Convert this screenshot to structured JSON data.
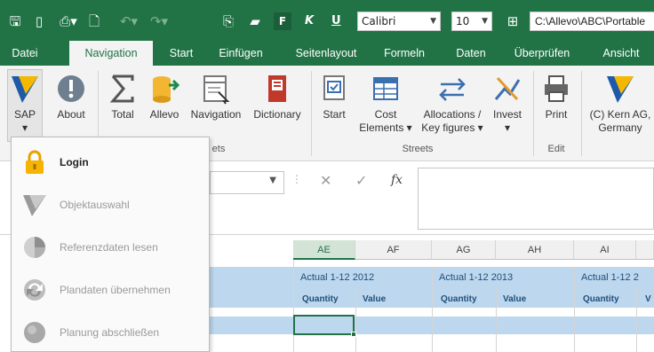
{
  "qat": {
    "font_name": "Calibri",
    "font_size": "10",
    "file_path": "C:\\Allevo\\ABC\\Portable",
    "bold_letter": "F",
    "italic_letter": "K",
    "underline_letter": "U"
  },
  "tabs": [
    "Datei",
    "Navigation",
    "Start",
    "Einfügen",
    "Seitenlayout",
    "Formeln",
    "Daten",
    "Überprüfen",
    "Ansicht"
  ],
  "active_tab": "Navigation",
  "ribbon": {
    "sap": "SAP",
    "about": "About",
    "total": "Total",
    "allevo": "Allevo",
    "navigation": "Navigation",
    "dictionary": "Dictionary",
    "start": "Start",
    "cost_line1": "Cost",
    "cost_line2": "Elements ▾",
    "alloc_line1": "Allocations /",
    "alloc_line2": "Key figures ▾",
    "invest": "Invest",
    "print": "Print",
    "kern_line1": "(C) Kern AG,",
    "kern_line2": "Germany",
    "group_sheets_fragment": "ets",
    "group_streets": "Streets",
    "group_edit": "Edit"
  },
  "formula": {
    "fx": "fx"
  },
  "grid": {
    "columns": [
      "AE",
      "AF",
      "AG",
      "AH",
      "AI"
    ],
    "selected_column": "AE",
    "group_headers": [
      "Actual 1-12 2012",
      "Actual 1-12 2013",
      "Actual 1-12 2"
    ],
    "sub_headers": [
      "Quantity",
      "Value",
      "Quantity",
      "Value",
      "Quantity",
      "V"
    ]
  },
  "dropdown": {
    "items": [
      {
        "label": "Login",
        "icon": "lock-icon",
        "enabled": true
      },
      {
        "label": "Objektauswahl",
        "icon": "sap-logo-icon",
        "enabled": false
      },
      {
        "label": "Referenzdaten lesen",
        "icon": "pie-chart-icon",
        "enabled": false
      },
      {
        "label": "Plandaten übernehmen",
        "icon": "refresh-icon",
        "enabled": false
      },
      {
        "label": "Planung abschließen",
        "icon": "circle-icon",
        "enabled": false
      }
    ]
  },
  "colors": {
    "excel_green": "#217346",
    "band_blue": "#bdd7ee",
    "header_text": "#1f4e79"
  }
}
